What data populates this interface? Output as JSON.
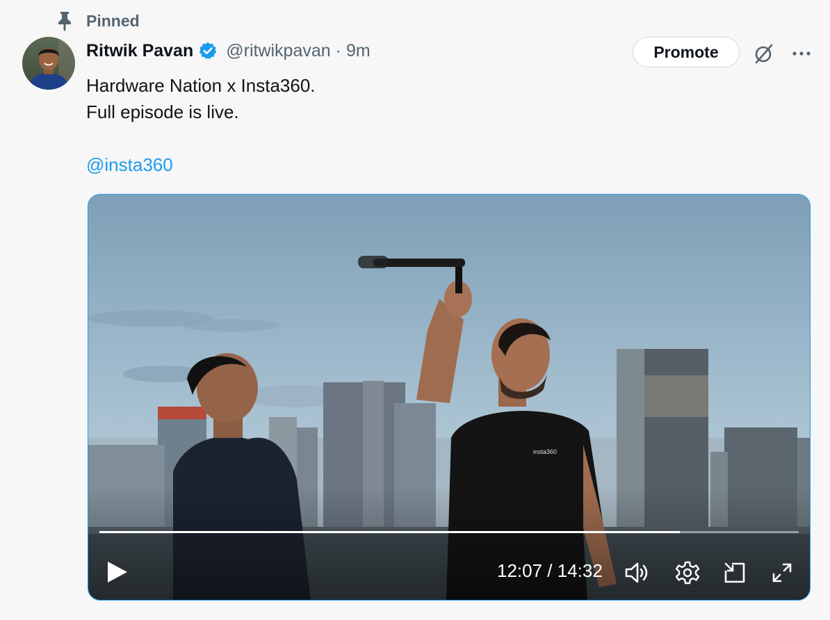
{
  "pinned": {
    "label": "Pinned",
    "icon": "pin-icon"
  },
  "author": {
    "display_name": "Ritwik Pavan",
    "verified": true,
    "handle": "@ritwikpavan",
    "separator": "·",
    "timestamp": "9m"
  },
  "actions": {
    "promote_label": "Promote",
    "grok_icon": "grok-icon",
    "more_icon": "more-icon"
  },
  "tweet": {
    "line1": "Hardware Nation x Insta360.",
    "line2": "Full episode is live.",
    "mention": "@insta360"
  },
  "video": {
    "shirt_text": "insta360",
    "current_time": "12:07",
    "duration": "14:32",
    "time_readout": "12:07 / 14:32",
    "progress_fraction": 0.83,
    "controls": [
      "play-icon",
      "volume-icon",
      "settings-icon",
      "picture-in-picture-icon",
      "fullscreen-icon"
    ]
  },
  "colors": {
    "accent": "#1d9bf0",
    "secondary_text": "#536471",
    "primary_text": "#0f1419"
  }
}
